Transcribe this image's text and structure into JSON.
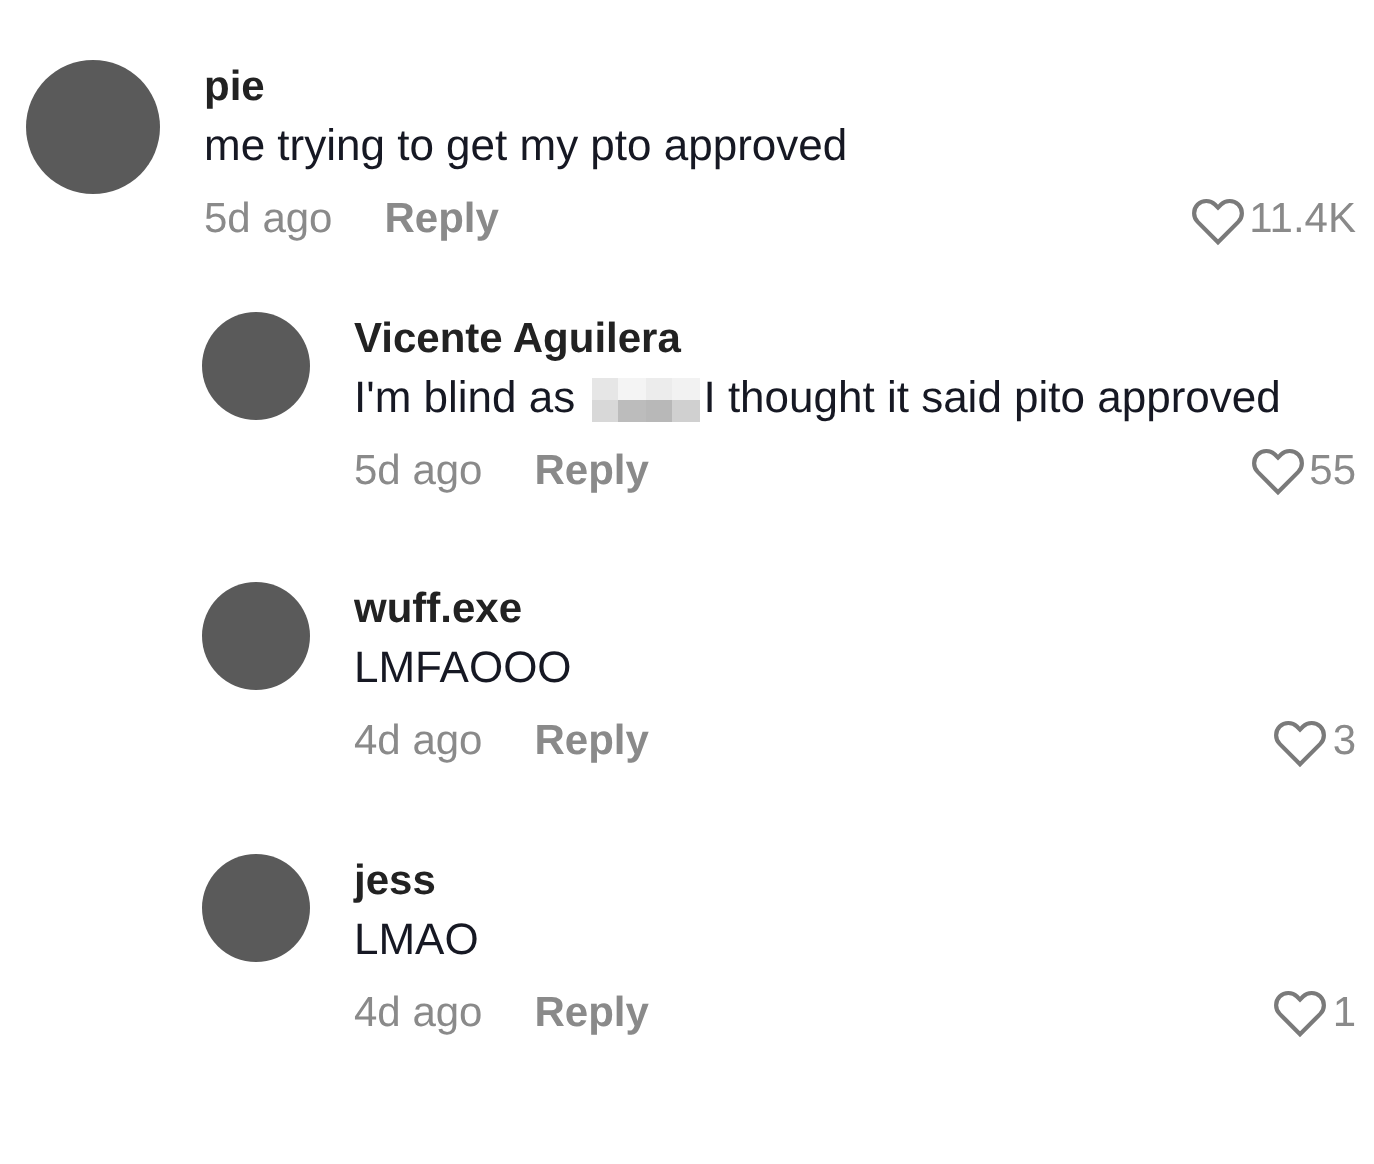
{
  "comments": [
    {
      "username": "pie",
      "text_parts": [
        "me trying to get my pto approved"
      ],
      "time": "5d ago",
      "reply_label": "Reply",
      "likes": "11.4K",
      "replies": [
        {
          "username": "Vicente Aguilera",
          "text_parts": [
            "I'm blind as",
            "I thought it said pito approved"
          ],
          "time": "5d ago",
          "reply_label": "Reply",
          "likes": "55"
        },
        {
          "username": "wuff.exe",
          "text_parts": [
            "LMFAOOO"
          ],
          "time": "4d ago",
          "reply_label": "Reply",
          "likes": "3"
        },
        {
          "username": "jess",
          "text_parts": [
            "LMAO"
          ],
          "time": "4d ago",
          "reply_label": "Reply",
          "likes": "1"
        }
      ]
    }
  ]
}
